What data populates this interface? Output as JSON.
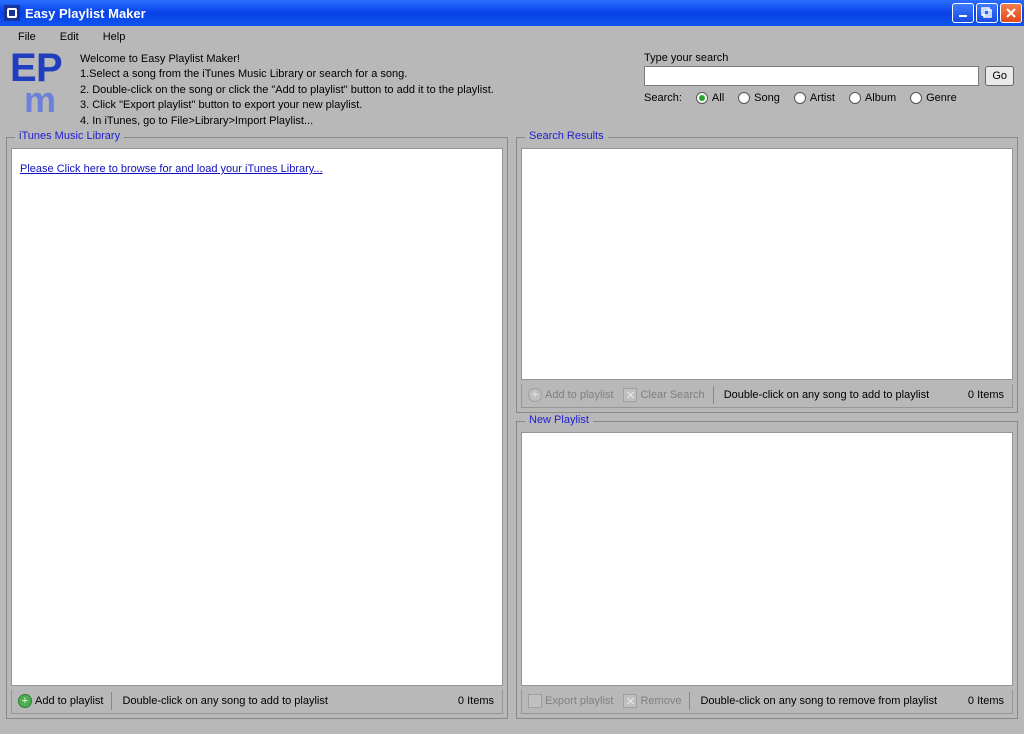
{
  "titlebar": {
    "title": "Easy Playlist Maker"
  },
  "menu": {
    "file": "File",
    "edit": "Edit",
    "help": "Help"
  },
  "welcome": {
    "heading": "Welcome to Easy Playlist Maker!",
    "step1": "1.Select a song from the iTunes Music Library or search for a song.",
    "step2": "2. Double-click on the song or click the \"Add to playlist\" button to add it to the playlist.",
    "step3": "3. Click \"Export playlist\" button to export your new playlist.",
    "step4": "4. In iTunes, go to File>Library>Import Playlist..."
  },
  "search": {
    "label": "Type your search",
    "value": "",
    "go": "Go",
    "filterLabel": "Search:",
    "all": "All",
    "song": "Song",
    "artist": "Artist",
    "album": "Album",
    "genre": "Genre"
  },
  "panels": {
    "library": {
      "legend": "iTunes Music Library",
      "loadLink": "Please Click here to browse for and load your iTunes Library...",
      "addBtn": "Add to playlist",
      "hint": "Double-click on any song to add to playlist",
      "count": "0 Items"
    },
    "results": {
      "legend": "Search Results",
      "addBtn": "Add to playlist",
      "clearBtn": "Clear Search",
      "hint": "Double-click on any song to add to playlist",
      "count": "0 Items"
    },
    "newPlaylist": {
      "legend": "New Playlist",
      "exportBtn": "Export playlist",
      "removeBtn": "Remove",
      "hint": "Double-click on any song to remove from playlist",
      "count": "0 Items"
    }
  }
}
